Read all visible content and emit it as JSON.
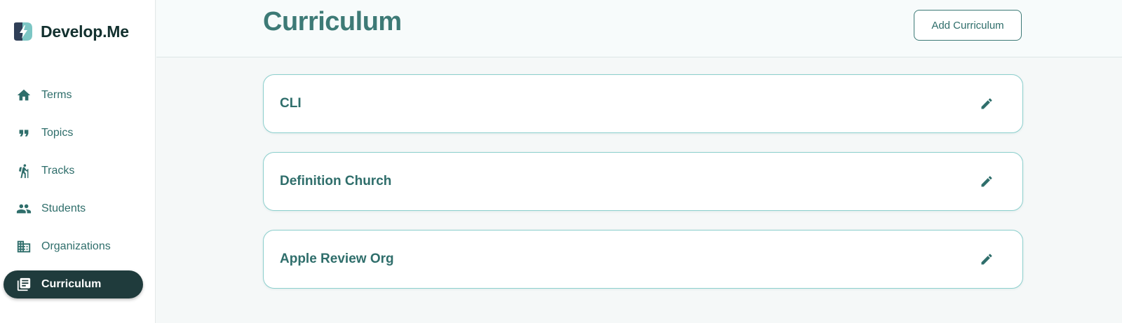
{
  "brand": {
    "name": "Develop.Me",
    "logo_icon": "lightning-bolt-logo"
  },
  "sidebar": {
    "items": [
      {
        "label": "Terms",
        "icon": "home-icon",
        "active": false
      },
      {
        "label": "Topics",
        "icon": "quote-icon",
        "active": false
      },
      {
        "label": "Tracks",
        "icon": "hiking-icon",
        "active": false
      },
      {
        "label": "Students",
        "icon": "people-icon",
        "active": false
      },
      {
        "label": "Organizations",
        "icon": "building-icon",
        "active": false
      },
      {
        "label": "Curriculum",
        "icon": "library-books-icon",
        "active": true
      }
    ]
  },
  "header": {
    "title": "Curriculum",
    "add_button_label": "Add Curriculum"
  },
  "curricula": [
    {
      "name": "CLI",
      "action_icon": "pencil-edit-icon"
    },
    {
      "name": "Definition Church",
      "action_icon": "pencil-edit-icon"
    },
    {
      "name": "Apple Review Org",
      "action_icon": "pencil-edit-icon"
    }
  ],
  "colors": {
    "primary": "#2f6e6b",
    "title": "#3d7a76",
    "active_nav_bg": "#1f3b3c",
    "card_border": "#8ccfcd",
    "page_bg": "#f5f8f8"
  }
}
